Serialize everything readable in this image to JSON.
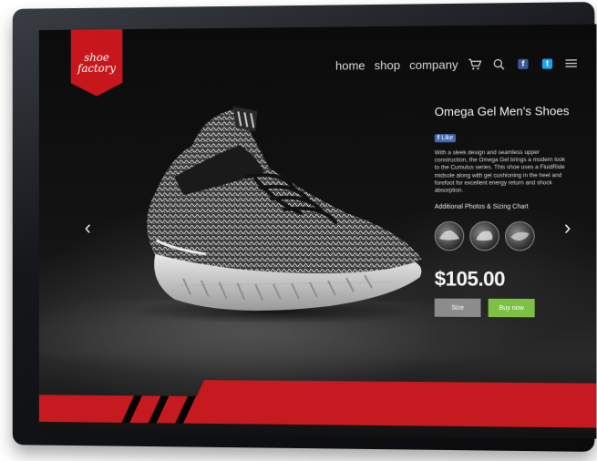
{
  "logo": {
    "line1": "shoe",
    "line2": "factory"
  },
  "nav": {
    "home": "home",
    "shop": "shop",
    "company": "company",
    "icons": [
      "cart-icon",
      "search-icon",
      "facebook-icon",
      "twitter-icon",
      "menu-icon"
    ],
    "facebook_glyph": "f",
    "twitter_glyph": "t"
  },
  "product": {
    "title": "Omega Gel Men's Shoes",
    "like_label": "Like",
    "like_glyph": "f",
    "description": "With a sleek design and seamless upper construction, the Omega Gel brings a modern look to the Cumulus series. This shoe uses a FluidRide midsole along with gel cushioning in the heel and forefoot for excellent energy return and shock absorption.",
    "additional_label": "Additional Photos & Sizing Chart",
    "price": "$105.00",
    "size_button": "Size",
    "buy_button": "Buy now"
  },
  "carousel": {
    "prev_glyph": "‹",
    "next_glyph": "›"
  },
  "colors": {
    "brand_red": "#c7161c",
    "buy_green": "#7cc144",
    "size_gray": "#8c8c8c",
    "facebook_blue": "#3b5998",
    "twitter_blue": "#1da1f2"
  }
}
